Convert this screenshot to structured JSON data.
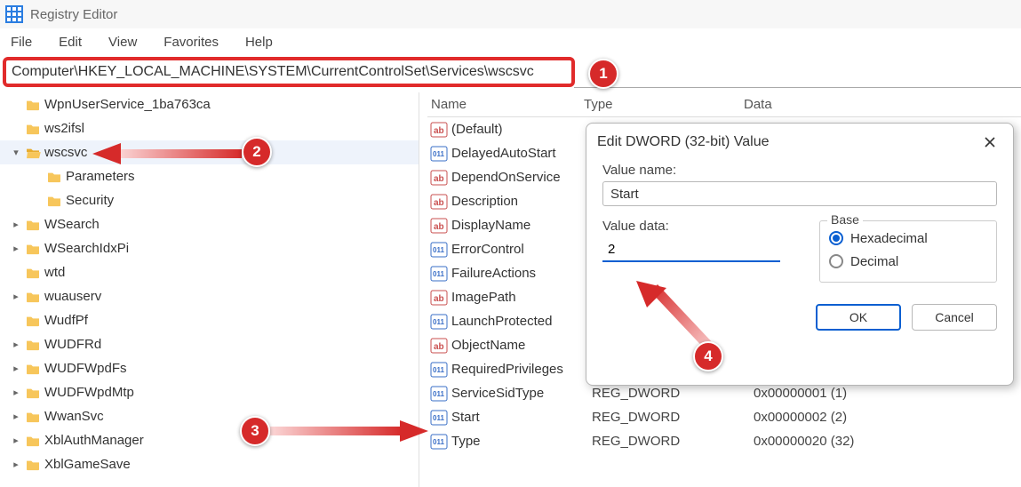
{
  "titlebar": {
    "title": "Registry Editor"
  },
  "menubar": [
    "File",
    "Edit",
    "View",
    "Favorites",
    "Help"
  ],
  "address": "Computer\\HKEY_LOCAL_MACHINE\\SYSTEM\\CurrentControlSet\\Services\\wscsvc",
  "columns": {
    "name": "Name",
    "type": "Type",
    "data": "Data"
  },
  "tree": [
    {
      "label": "WpnUserService_1ba763ca",
      "depth": 0,
      "open": false,
      "chev": ""
    },
    {
      "label": "ws2ifsl",
      "depth": 0,
      "open": false,
      "chev": ""
    },
    {
      "label": "wscsvc",
      "depth": 0,
      "open": true,
      "chev": "v"
    },
    {
      "label": "Parameters",
      "depth": 1,
      "open": false,
      "chev": ""
    },
    {
      "label": "Security",
      "depth": 1,
      "open": false,
      "chev": ""
    },
    {
      "label": "WSearch",
      "depth": 0,
      "open": false,
      "chev": ">"
    },
    {
      "label": "WSearchIdxPi",
      "depth": 0,
      "open": false,
      "chev": ">"
    },
    {
      "label": "wtd",
      "depth": 0,
      "open": false,
      "chev": ""
    },
    {
      "label": "wuauserv",
      "depth": 0,
      "open": false,
      "chev": ">"
    },
    {
      "label": "WudfPf",
      "depth": 0,
      "open": false,
      "chev": ""
    },
    {
      "label": "WUDFRd",
      "depth": 0,
      "open": false,
      "chev": ">"
    },
    {
      "label": "WUDFWpdFs",
      "depth": 0,
      "open": false,
      "chev": ">"
    },
    {
      "label": "WUDFWpdMtp",
      "depth": 0,
      "open": false,
      "chev": ">"
    },
    {
      "label": "WwanSvc",
      "depth": 0,
      "open": false,
      "chev": ">"
    },
    {
      "label": "XblAuthManager",
      "depth": 0,
      "open": false,
      "chev": ">"
    },
    {
      "label": "XblGameSave",
      "depth": 0,
      "open": false,
      "chev": ">"
    }
  ],
  "values": [
    {
      "name": "(Default)",
      "kind": "sz",
      "type": "",
      "data": ""
    },
    {
      "name": "DelayedAutoStart",
      "kind": "dw",
      "type": "",
      "data": ""
    },
    {
      "name": "DependOnService",
      "kind": "sz",
      "type": "",
      "data": ""
    },
    {
      "name": "Description",
      "kind": "sz",
      "type": "",
      "data": ""
    },
    {
      "name": "DisplayName",
      "kind": "sz",
      "type": "",
      "data": ""
    },
    {
      "name": "ErrorControl",
      "kind": "dw",
      "type": "",
      "data": ""
    },
    {
      "name": "FailureActions",
      "kind": "dw",
      "type": "",
      "data": ""
    },
    {
      "name": "ImagePath",
      "kind": "sz",
      "type": "",
      "data": ""
    },
    {
      "name": "LaunchProtected",
      "kind": "dw",
      "type": "",
      "data": ""
    },
    {
      "name": "ObjectName",
      "kind": "sz",
      "type": "",
      "data": ""
    },
    {
      "name": "RequiredPrivileges",
      "kind": "dw",
      "type": "",
      "data": ""
    },
    {
      "name": "ServiceSidType",
      "kind": "dw",
      "type": "REG_DWORD",
      "data": "0x00000001 (1)"
    },
    {
      "name": "Start",
      "kind": "dw",
      "type": "REG_DWORD",
      "data": "0x00000002 (2)"
    },
    {
      "name": "Type",
      "kind": "dw",
      "type": "REG_DWORD",
      "data": "0x00000020 (32)"
    }
  ],
  "dialog": {
    "title": "Edit DWORD (32-bit) Value",
    "valueNameLabel": "Value name:",
    "valueName": "Start",
    "valueDataLabel": "Value data:",
    "valueData": "2",
    "baseLabel": "Base",
    "hexLabel": "Hexadecimal",
    "decLabel": "Decimal",
    "ok": "OK",
    "cancel": "Cancel"
  },
  "annotations": {
    "b1": "1",
    "b2": "2",
    "b3": "3",
    "b4": "4"
  }
}
